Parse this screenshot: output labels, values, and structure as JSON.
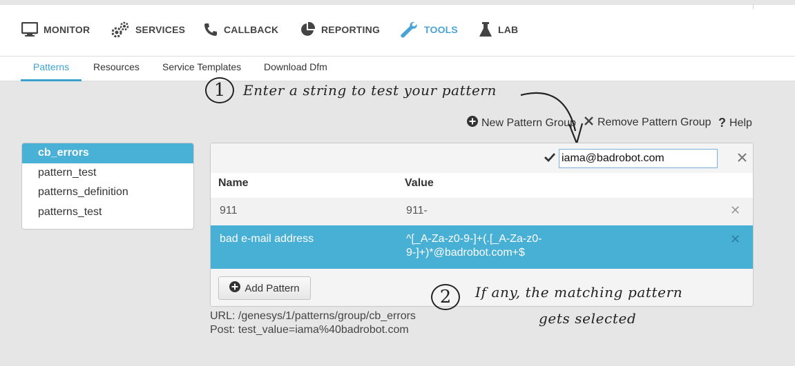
{
  "nav": {
    "items": [
      {
        "label": "MONITOR",
        "icon": "monitor-icon"
      },
      {
        "label": "SERVICES",
        "icon": "gears-icon"
      },
      {
        "label": "CALLBACK",
        "icon": "phone-icon"
      },
      {
        "label": "REPORTING",
        "icon": "pie-chart-icon"
      },
      {
        "label": "TOOLS",
        "icon": "wrench-icon",
        "active": true
      },
      {
        "label": "LAB",
        "icon": "flask-icon"
      }
    ],
    "active_color": "#4aa3d6"
  },
  "subnav": {
    "items": [
      {
        "label": "Patterns",
        "active": true
      },
      {
        "label": "Resources"
      },
      {
        "label": "Service Templates"
      },
      {
        "label": "Download Dfm"
      }
    ]
  },
  "annotations": {
    "step1_number": "1",
    "step1_text": "Enter a string to test your pattern",
    "step2_number": "2",
    "step2_text_line1": "If any, the matching pattern",
    "step2_text_line2": "gets selected"
  },
  "toolbar": {
    "new_group": "New Pattern Group",
    "remove_group": "Remove Pattern Group",
    "help": "Help"
  },
  "groups": {
    "items": [
      {
        "label": "cb_errors",
        "active": true
      },
      {
        "label": "pattern_test"
      },
      {
        "label": "patterns_definition"
      },
      {
        "label": "patterns_test"
      }
    ],
    "selected_color": "#4ab1d6"
  },
  "panel": {
    "test_value": "iama@badrobot.com",
    "columns": {
      "name": "Name",
      "value": "Value"
    },
    "rows": [
      {
        "name": "911",
        "value": "911-",
        "selected": false
      },
      {
        "name": "bad e-mail address",
        "value_line1": "^[_A-Za-z0-9-]+(.[_A-Za-z0-",
        "value_line2": "9-]+)*@badrobot.com+$",
        "selected": true
      }
    ],
    "add_button": "Add Pattern"
  },
  "info": {
    "url": "URL: /genesys/1/patterns/group/cb_errors",
    "post": "Post: test_value=iama%40badrobot.com"
  }
}
